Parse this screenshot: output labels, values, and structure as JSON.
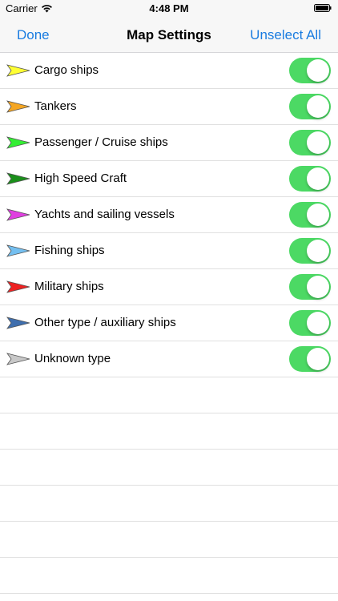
{
  "status_bar": {
    "carrier": "Carrier",
    "time": "4:48 PM",
    "wifi_icon": "wifi-icon",
    "battery_icon": "battery-icon"
  },
  "nav": {
    "left_button": "Done",
    "title": "Map Settings",
    "right_button": "Unselect All"
  },
  "ship_types": [
    {
      "label": "Cargo ships",
      "color": "#ffff33",
      "enabled": true
    },
    {
      "label": "Tankers",
      "color": "#f5a623",
      "enabled": true
    },
    {
      "label": "Passenger / Cruise ships",
      "color": "#33ee33",
      "enabled": true
    },
    {
      "label": "High Speed Craft",
      "color": "#1a8f1a",
      "enabled": true
    },
    {
      "label": "Yachts and sailing vessels",
      "color": "#e040e0",
      "enabled": true
    },
    {
      "label": "Fishing ships",
      "color": "#74bff0",
      "enabled": true
    },
    {
      "label": "Military ships",
      "color": "#ee2222",
      "enabled": true
    },
    {
      "label": "Other type / auxiliary ships",
      "color": "#3f6fae",
      "enabled": true
    },
    {
      "label": "Unknown type",
      "color": "#c8c8c8",
      "enabled": true
    }
  ],
  "toggle_on_color": "#4cd964",
  "accent_color": "#1a7ce0"
}
